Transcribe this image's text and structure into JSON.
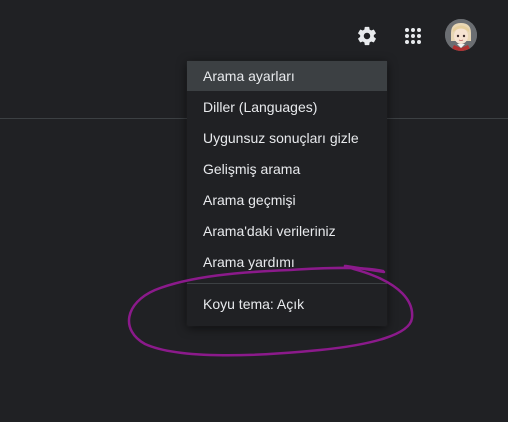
{
  "header": {
    "settings_icon": "gear-icon",
    "apps_icon": "apps-grid-icon",
    "avatar_icon": "user-avatar"
  },
  "menu": {
    "items": [
      {
        "label": "Arama ayarları"
      },
      {
        "label": "Diller  (Languages)"
      },
      {
        "label": "Uygunsuz sonuçları gizle"
      },
      {
        "label": "Gelişmiş arama"
      },
      {
        "label": "Arama geçmişi"
      },
      {
        "label": "Arama'daki verileriniz"
      },
      {
        "label": "Arama yardımı"
      }
    ],
    "theme_label": "Koyu tema: Açık"
  },
  "colors": {
    "background": "#202124",
    "menu_text": "#e8eaed",
    "highlight": "#3c4043",
    "annotation": "#8b1a8b"
  }
}
